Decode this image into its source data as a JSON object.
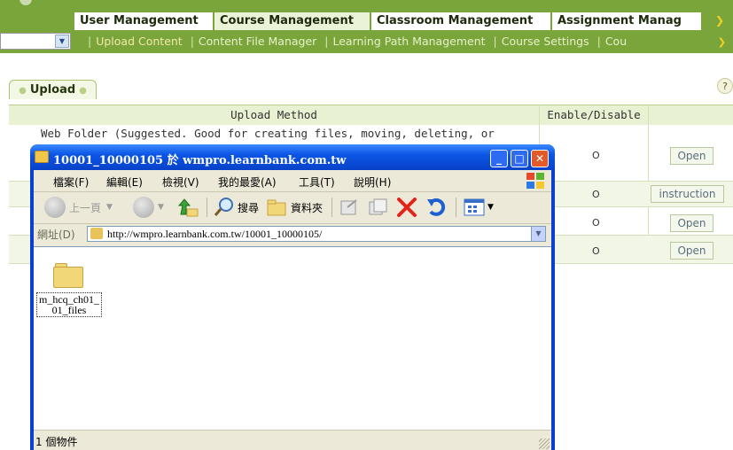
{
  "top_tabs": [
    {
      "label": "User Management",
      "active": false
    },
    {
      "label": "Course Management",
      "active": true
    },
    {
      "label": "Classroom Management",
      "active": false
    },
    {
      "label": "Assignment Manag",
      "active": false
    }
  ],
  "sub_nav": {
    "links": [
      "Upload Content",
      "Content File Manager",
      "Learning Path Management",
      "Course Settings",
      "Cou"
    ],
    "current": "Upload Content"
  },
  "upload_tab": {
    "label": "Upload"
  },
  "help_label": "?",
  "method_table": {
    "headers": [
      "Upload Method",
      "Enable/Disable"
    ],
    "rows": [
      {
        "method": "Web Folder (Suggested. Good for creating files, moving, deleting, or",
        "status": "O",
        "action": "Open"
      },
      {
        "method": "",
        "status": "O",
        "action": "instruction"
      },
      {
        "method": "",
        "status": "O",
        "action": "Open"
      },
      {
        "method": "",
        "status": "O",
        "action": "Open"
      }
    ]
  },
  "explorer": {
    "title": "10001_10000105 於 wmpro.learnbank.com.tw",
    "menu": [
      "檔案(F)",
      "編輯(E)",
      "檢視(V)",
      "我的最愛(A)",
      "工具(T)",
      "說明(H)"
    ],
    "toolbar": {
      "back": "上一頁",
      "search": "搜尋",
      "folders": "資料夾"
    },
    "address_label": "網址(D)",
    "address": "http://wmpro.learnbank.com.tw/10001_10000105/",
    "items": [
      {
        "name_line1": "m_hcq_ch01_",
        "name_line2": "01_files"
      }
    ],
    "status": "1 個物件"
  },
  "colors": {
    "nav_green": "#7aa53b",
    "xp_blue": "#0a3fcf"
  }
}
